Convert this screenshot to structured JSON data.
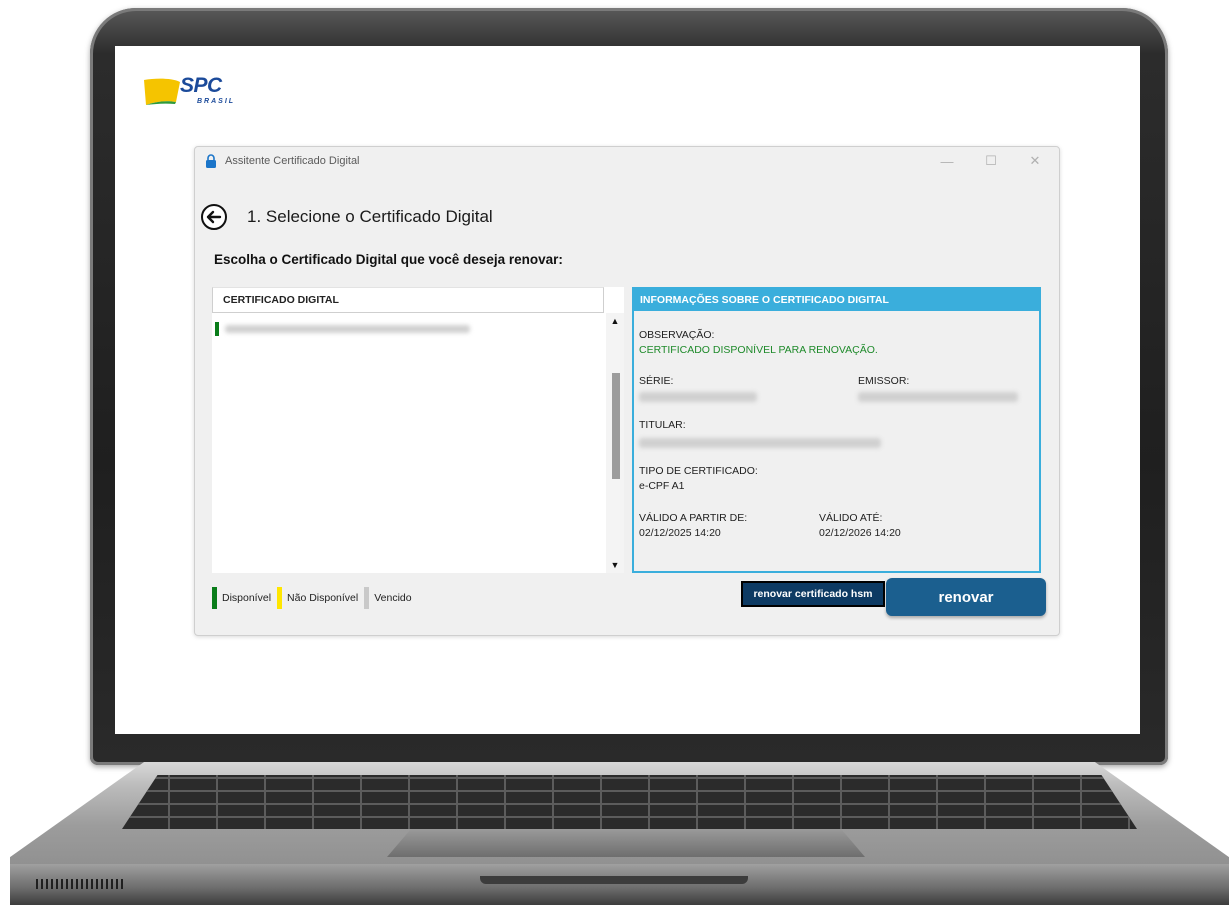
{
  "logo": {
    "text": "SPC",
    "subtext": "BRASIL"
  },
  "window": {
    "title": "Assitente Certificado Digital",
    "controls": [
      "—",
      "☐",
      "✕"
    ]
  },
  "step_title": "1. Selecione o Certificado Digital",
  "instruction": "Escolha o Certificado Digital que você deseja renovar:",
  "list": {
    "header": "CERTIFICADO DIGITAL",
    "items": [
      {
        "name": "",
        "status": "Disponível",
        "status_color": "#0a7d1a"
      }
    ]
  },
  "info": {
    "header": "INFORMAÇÕES SOBRE O CERTIFICADO DIGITAL",
    "observacao_label": "OBSERVAÇÃO:",
    "observacao_value": "CERTIFICADO DISPONÍVEL PARA RENOVAÇÃO.",
    "serie_label": "SÉRIE:",
    "serie_value": "",
    "emissor_label": "EMISSOR:",
    "emissor_value": "",
    "titular_label": "TITULAR:",
    "titular_value": "",
    "tipo_label": "TIPO DE CERTIFICADO:",
    "tipo_value": "e-CPF A1",
    "valido_de_label": "VÁLIDO A PARTIR DE:",
    "valido_de_value": "02/12/2025 14:20",
    "valido_ate_label": "VÁLIDO ATÉ:",
    "valido_ate_value": "02/12/2026 14:20"
  },
  "legend": [
    {
      "label": "Disponível",
      "color": "#0a7d1a"
    },
    {
      "label": "Não Disponível",
      "color": "#ffe600"
    },
    {
      "label": "Vencido",
      "color": "#c9c9c9"
    }
  ],
  "buttons": {
    "hsm": "renovar certificado hsm",
    "renew": "renovar"
  },
  "colors": {
    "accent": "#3aaedc",
    "primary_button": "#1b5f8f",
    "hsm_button": "#0d3a63",
    "ok_text": "#1e8a2a"
  }
}
